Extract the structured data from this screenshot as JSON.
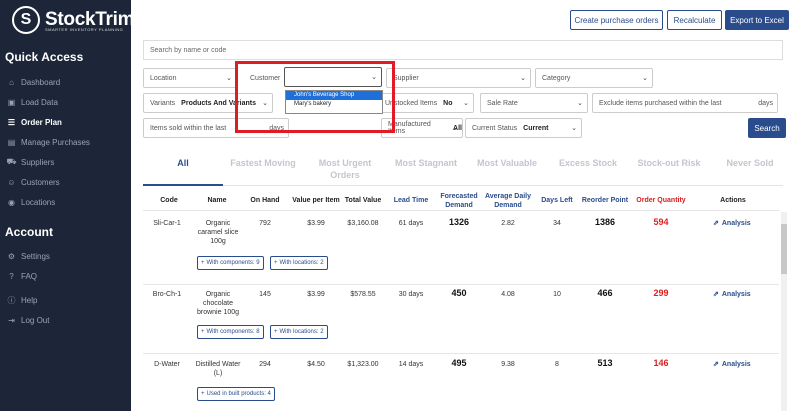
{
  "brand": {
    "name": "StockTrim",
    "tagline": "SMARTER INVENTORY PLANNING",
    "mark": "S"
  },
  "sidebar": {
    "quick_access": "Quick Access",
    "items": [
      {
        "label": "Dashboard",
        "icon": "dashboard-icon"
      },
      {
        "label": "Load Data",
        "icon": "load-data-icon"
      },
      {
        "label": "Order Plan",
        "icon": "order-plan-icon",
        "active": true
      },
      {
        "label": "Manage Purchases",
        "icon": "manage-purchases-icon"
      },
      {
        "label": "Suppliers",
        "icon": "suppliers-icon"
      },
      {
        "label": "Customers",
        "icon": "customers-icon"
      },
      {
        "label": "Locations",
        "icon": "locations-icon"
      }
    ],
    "account": "Account",
    "account_items": [
      {
        "label": "Settings",
        "icon": "gear-icon"
      },
      {
        "label": "FAQ",
        "icon": "faq-icon"
      },
      {
        "label": "Help",
        "icon": "help-icon"
      },
      {
        "label": "Log Out",
        "icon": "logout-icon"
      }
    ]
  },
  "toolbar": {
    "create_po": "Create purchase orders",
    "recalculate": "Recalculate",
    "export": "Export to Excel"
  },
  "search": {
    "placeholder": "Search by name or code"
  },
  "filters": {
    "location": "Location",
    "customer": "Customer",
    "customer_value": "",
    "supplier": "Supplier",
    "category": "Category",
    "variants_label": "Variants",
    "variants_value": "Products And Variants",
    "unstocked_label": "Unstocked Items",
    "unstocked_value": "No",
    "sale_rate": "Sale Rate",
    "exclude_label": "Exclude items purchased within the last",
    "exclude_suffix": "days",
    "sold_within_label": "Items sold within the last",
    "sold_within_suffix": "days",
    "manufactured_label": "Manufactured Items",
    "manufactured_value": "All",
    "status_label": "Current Status",
    "status_value": "Current",
    "search_button": "Search"
  },
  "customer_dropdown": {
    "options": [
      "John's Beverage Shop",
      "Mary's bakery"
    ],
    "selected_index": 0
  },
  "tabs": [
    {
      "label": "All",
      "active": true
    },
    {
      "label": "Fastest Moving"
    },
    {
      "label": "Most Urgent\nOrders"
    },
    {
      "label": "Most Stagnant"
    },
    {
      "label": "Most Valuable"
    },
    {
      "label": "Excess Stock"
    },
    {
      "label": "Stock-out Risk"
    },
    {
      "label": "Never Sold"
    }
  ],
  "table": {
    "headers": {
      "code": "Code",
      "name": "Name",
      "on_hand": "On Hand",
      "value_per_item": "Value per Item",
      "total_value": "Total Value",
      "lead_time": "Lead Time",
      "forecasted_demand": "Forecasted\nDemand",
      "avg_daily_demand": "Average Daily\nDemand",
      "days_left": "Days Left",
      "reorder_point": "Reorder Point",
      "order_quantity": "Order Quantity",
      "actions": "Actions"
    },
    "rows": [
      {
        "code": "Sli-Car-1",
        "name": "Organic\ncaramel slice\n100g",
        "on_hand": "792",
        "value_per_item": "$3.99",
        "total_value": "$3,160.08",
        "lead_time": "61 days",
        "forecasted_demand": "1326",
        "avg_daily_demand": "2.82",
        "days_left": "34",
        "reorder_point": "1386",
        "order_quantity": "594",
        "action": "Analysis",
        "chips": [
          "With components: 9",
          "With locations: 2"
        ]
      },
      {
        "code": "Bro-Ch-1",
        "name": "Organic\nchocolate\nbrownie 100g",
        "on_hand": "145",
        "value_per_item": "$3.99",
        "total_value": "$578.55",
        "lead_time": "30 days",
        "forecasted_demand": "450",
        "avg_daily_demand": "4.08",
        "days_left": "10",
        "reorder_point": "466",
        "order_quantity": "299",
        "action": "Analysis",
        "chips": [
          "With components: 8",
          "With locations: 2"
        ]
      },
      {
        "code": "D-Water",
        "name": "Distilled Water\n(L)",
        "on_hand": "294",
        "value_per_item": "$4.50",
        "total_value": "$1,323.00",
        "lead_time": "14 days",
        "forecasted_demand": "495",
        "avg_daily_demand": "9.38",
        "days_left": "8",
        "reorder_point": "513",
        "order_quantity": "146",
        "action": "Analysis",
        "chips": [
          "Used in built products: 4"
        ]
      }
    ]
  }
}
